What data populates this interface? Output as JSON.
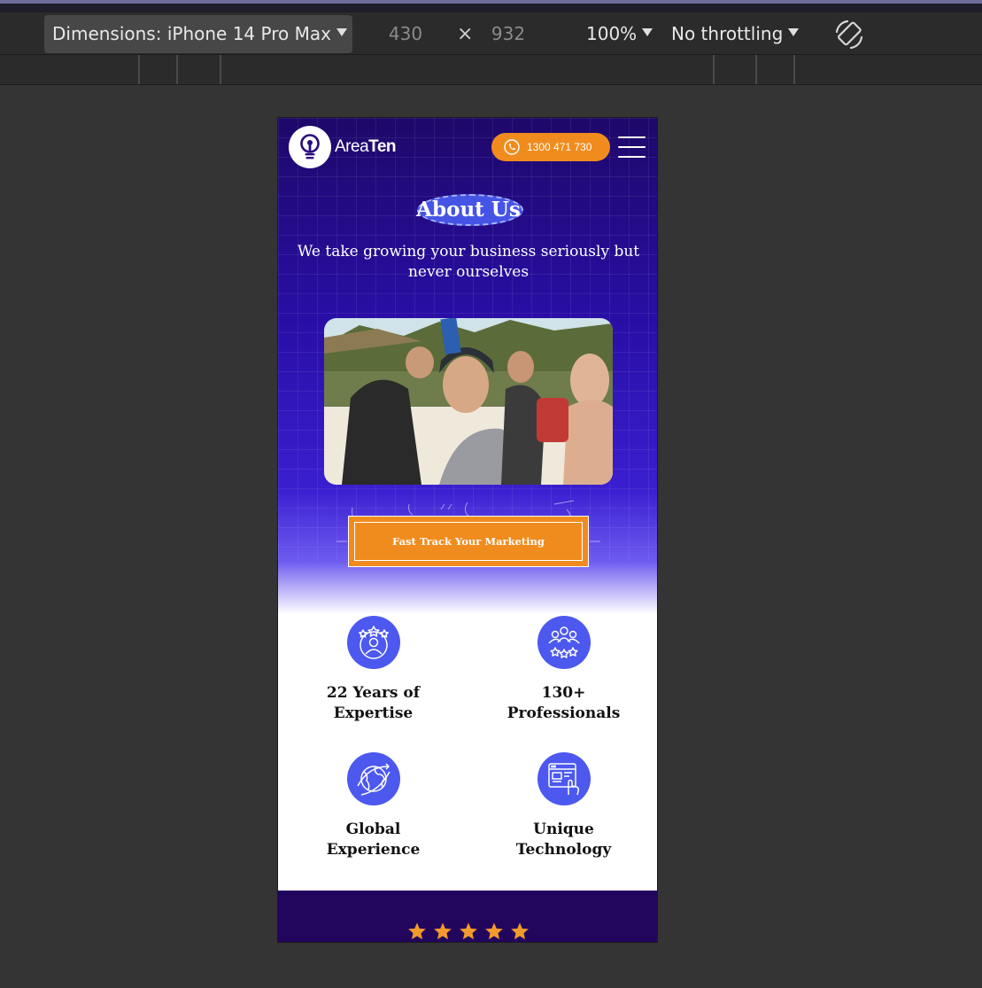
{
  "devtools": {
    "dimensions_label": "Dimensions: iPhone 14 Pro Max",
    "width": "430",
    "times": "×",
    "height": "932",
    "zoom": "100%",
    "throttling": "No throttling"
  },
  "site": {
    "logo_light": "Area",
    "logo_bold": "Ten",
    "phone": "1300 471 730",
    "heading": "About Us",
    "tagline": "We take growing your business seriously but never ourselves",
    "cta": "Fast Track Your Marketing",
    "features": [
      {
        "line1": "22 Years of",
        "line2": "Expertise",
        "icon": "star-person-icon"
      },
      {
        "line1": "130+",
        "line2": "Professionals",
        "icon": "team-stars-icon"
      },
      {
        "line1": "Global",
        "line2": "Experience",
        "icon": "globe-icon"
      },
      {
        "line1": "Unique",
        "line2": "Technology",
        "icon": "web-technology-icon"
      }
    ],
    "rating_stars": 5
  },
  "colors": {
    "brand_purple": "#290ea6",
    "accent_orange": "#f08c1e",
    "icon_blue": "#4c58ee"
  }
}
